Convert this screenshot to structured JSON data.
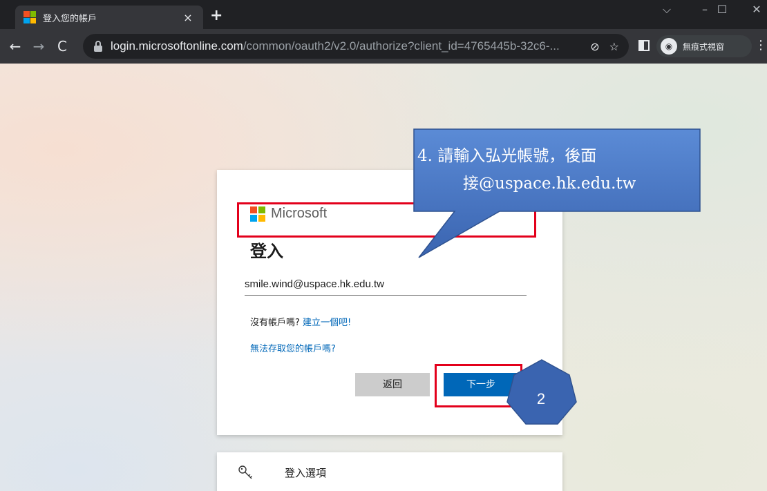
{
  "browser": {
    "tab_title": "登入您的帳戶",
    "tab_close": "×",
    "new_tab": "+",
    "url_host": "login.microsoftonline.com",
    "url_path": "/common/oauth2/v2.0/authorize?client_id=4765445b-32c6-...",
    "incognito_label": "無痕式視窗",
    "window_controls": {
      "dropdown": "⌵",
      "minimize": "–",
      "maximize": "☐",
      "close": "✕"
    },
    "nav": {
      "back": "←",
      "forward": "→",
      "reload": "C"
    },
    "icons": {
      "eye_slash": "⊘",
      "star": "☆",
      "menu": "⋮",
      "incognito": "◉"
    }
  },
  "login_card": {
    "brand": "Microsoft",
    "title": "登入",
    "email_value": "smile.wind@uspace.hk.edu.tw",
    "no_account_text": "沒有帳戶嗎? ",
    "create_link": "建立一個吧!",
    "cant_access_link": "無法存取您的帳戶嗎?",
    "back_button": "返回",
    "next_button": "下一步"
  },
  "options_card": {
    "label": "登入選項"
  },
  "annotations": {
    "callout_line1": "4.  請輸入弘光帳號，後面",
    "callout_line2": "接@uspace.hk.edu.tw",
    "step_number": "2",
    "callout_color": "#4472c4",
    "highlight_color": "#e3001b"
  }
}
